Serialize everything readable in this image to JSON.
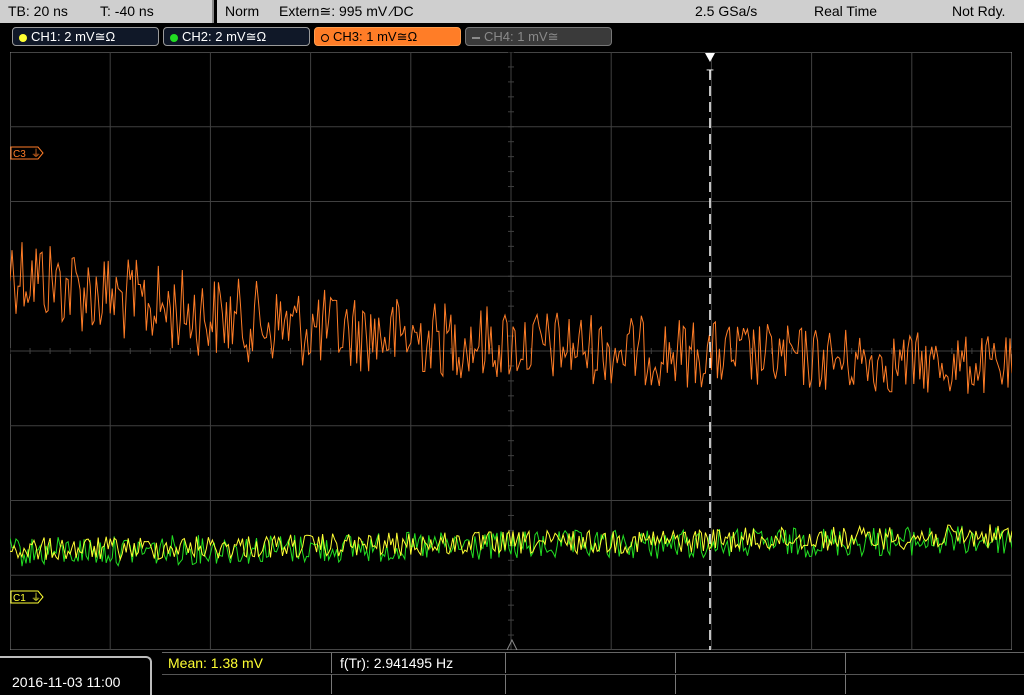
{
  "header": {
    "timebase": "TB: 20 ns",
    "trigger_time": "T: -40 ns",
    "mode": "Norm",
    "trigger_source": "Extern≅: 995 mV ⁄DC",
    "sample_rate": "2.5 GSa/s",
    "acq_mode": "Real Time",
    "status": "Not Rdy."
  },
  "channels": [
    {
      "label": "CH1: 2 mV≅Ω",
      "color": "#ffff33"
    },
    {
      "label": "CH2: 2 mV≅Ω",
      "color": "#22dd22"
    },
    {
      "label": "CH3: 1 mV≅Ω",
      "color": "#ff7d27"
    },
    {
      "label": "CH4: 1 mV≅",
      "color": "#8a8a8a"
    }
  ],
  "markers": {
    "c3": "C3",
    "c1": "C1",
    "trigger": "T"
  },
  "footer": {
    "datetime": "2016-11-03 11:00",
    "mean": "Mean: 1.38 mV",
    "freq": "f(Tr): 2.941495 Hz"
  },
  "colors": {
    "grid": "#404040",
    "ch1": "#ffff33",
    "ch2": "#22dd22",
    "ch3": "#ff7d27"
  }
}
